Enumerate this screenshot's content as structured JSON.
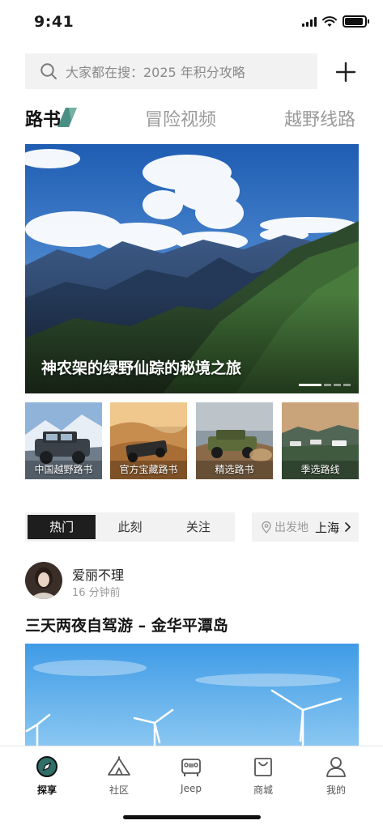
{
  "status_bar": {
    "time": "9:41",
    "battery_level": 0.9
  },
  "search": {
    "placeholder": "大家都在搜：2025 年积分攻略"
  },
  "top_tabs": [
    {
      "label": "路书",
      "active": true
    },
    {
      "label": "冒险视频",
      "active": false
    },
    {
      "label": "越野线路",
      "active": false
    }
  ],
  "banner": {
    "title": "神农架的绿野仙踪的秘境之旅",
    "slide_count": 4,
    "active_slide": 1
  },
  "categories": [
    {
      "label": "中国越野路书"
    },
    {
      "label": "官方宝藏路书"
    },
    {
      "label": "精选路书"
    },
    {
      "label": "季选路线"
    }
  ],
  "feed_filter": {
    "tabs": [
      {
        "label": "热门",
        "active": true
      },
      {
        "label": "此刻",
        "active": false
      },
      {
        "label": "关注",
        "active": false
      }
    ],
    "origin_label": "出发地",
    "origin_city": "上海"
  },
  "post": {
    "author": "爱丽不理",
    "time": "16 分钟前",
    "title": "三天两夜自驾游 – 金华平潭岛"
  },
  "bottom_nav": [
    {
      "label": "探享",
      "icon": "compass-icon",
      "active": true
    },
    {
      "label": "社区",
      "icon": "tent-icon",
      "active": false
    },
    {
      "label": "Jeep",
      "icon": "jeep-icon",
      "active": false
    },
    {
      "label": "商城",
      "icon": "shopping-bag-icon",
      "active": false
    },
    {
      "label": "我的",
      "icon": "user-icon",
      "active": false
    }
  ],
  "colors": {
    "accent": "#1e1e1e",
    "tab_accent": "#4a8f86",
    "muted": "#9a9a9a",
    "search_bg": "#f2f2f2"
  }
}
